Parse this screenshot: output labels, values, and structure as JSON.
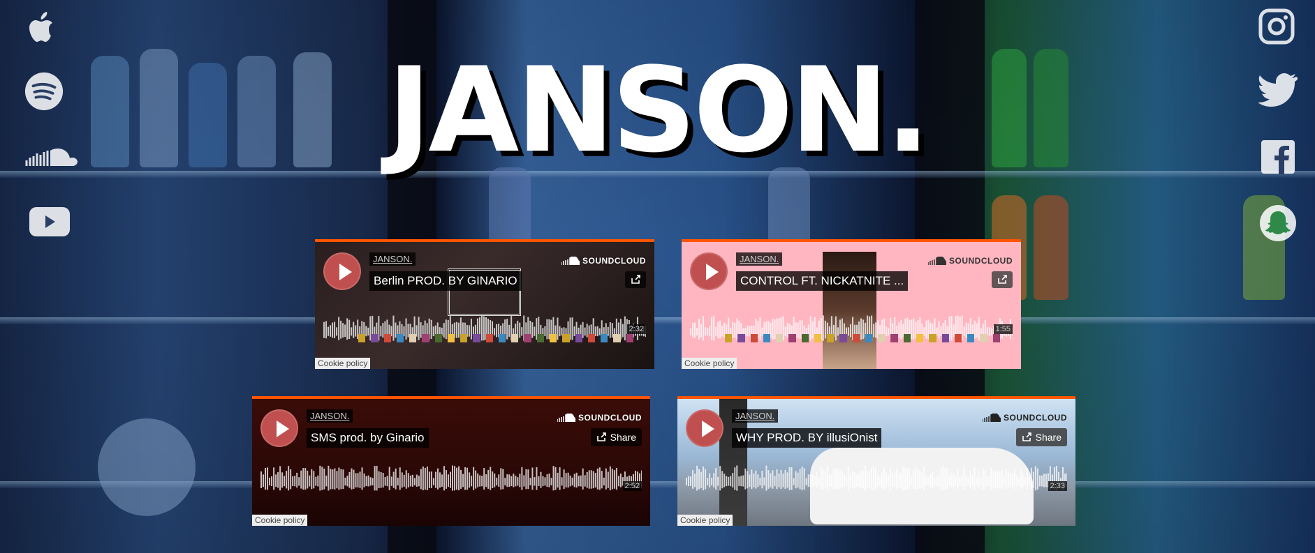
{
  "site": {
    "title": "JANSON."
  },
  "left_icons": [
    "apple-music-icon",
    "spotify-icon",
    "soundcloud-icon",
    "youtube-icon"
  ],
  "right_icons": [
    "instagram-icon",
    "twitter-icon",
    "facebook-icon",
    "snapchat-icon"
  ],
  "widgets": [
    {
      "artist": "JANSON.",
      "track": "Berlin PROD. BY GINARIO",
      "duration": "2:32",
      "brand": "SOUNDCLOUD",
      "share_label": "",
      "cookie": "Cookie policy"
    },
    {
      "artist": "JANSON.",
      "track": "CONTROL FT. NICKATNITE ...",
      "duration": "1:55",
      "brand": "SOUNDCLOUD",
      "share_label": "",
      "cookie": "Cookie policy"
    },
    {
      "artist": "JANSON.",
      "track": "SMS prod. by Ginario",
      "duration": "2:52",
      "brand": "SOUNDCLOUD",
      "share_label": "Share",
      "cookie": "Cookie policy"
    },
    {
      "artist": "JANSON.",
      "track": "WHY PROD. BY illusiOnist",
      "duration": "2:33",
      "brand": "SOUNDCLOUD",
      "share_label": "Share",
      "cookie": "Cookie policy"
    }
  ],
  "colors": {
    "accent": "#ff5500",
    "play": "#c0504f",
    "title": "#ffffff"
  }
}
